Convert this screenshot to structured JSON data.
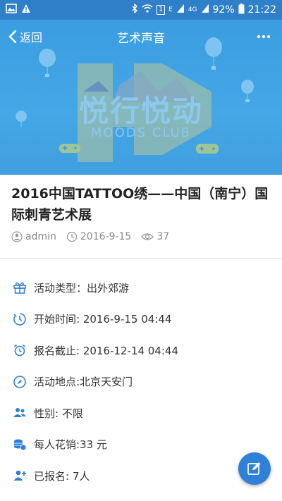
{
  "status_bar": {
    "battery": "92%",
    "time": "21:22",
    "network_4g": "4G",
    "sim_number": "1",
    "carrier_letter": "E"
  },
  "nav": {
    "back_label": "返回",
    "title": "艺术声音"
  },
  "banner": {
    "brand_text": "悦行悦动",
    "club_text": "MOODS CLUB"
  },
  "article": {
    "title": "2016中国TATTOO绣——中国（南宁）国际刺青艺术展",
    "author": "admin",
    "date": "2016-9-15",
    "views": "37"
  },
  "info": [
    {
      "icon": "gift-icon",
      "text": "活动类型：出外郊游"
    },
    {
      "icon": "timer-icon",
      "text": "开始时间: 2016-9-15 04:44"
    },
    {
      "icon": "alarm-clock-icon",
      "text": "报名截止: 2016-12-14 04:44"
    },
    {
      "icon": "compass-icon",
      "text": "活动地点:北京天安门"
    },
    {
      "icon": "people-icon",
      "text": "性别: 不限"
    },
    {
      "icon": "coins-icon",
      "text": "每人花销:33 元"
    },
    {
      "icon": "add-user-icon",
      "text": "已报名: 7人"
    }
  ],
  "colors": {
    "accent": "#2f80c8",
    "icon_blue": "#2f7fd6",
    "banner_blue": "#3f9fe0"
  }
}
